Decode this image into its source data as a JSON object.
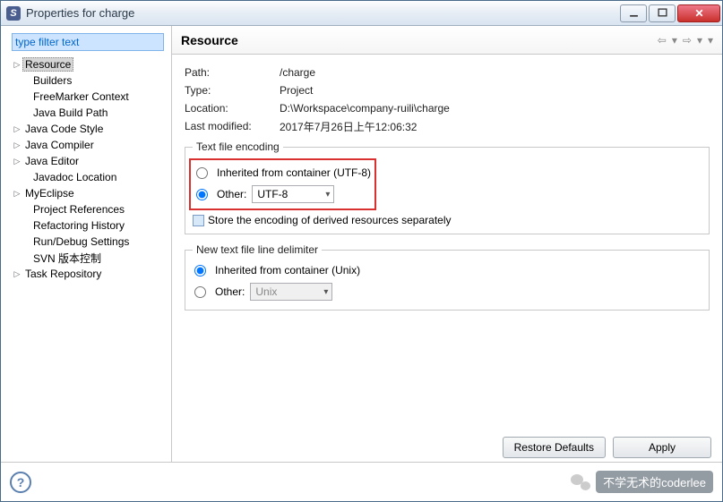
{
  "window": {
    "title": "Properties for charge"
  },
  "sidebar": {
    "filter_placeholder": "type filter text",
    "items": [
      {
        "label": "Resource",
        "expandable": true,
        "selected": true
      },
      {
        "label": "Builders",
        "child": true
      },
      {
        "label": "FreeMarker Context",
        "child": true
      },
      {
        "label": "Java Build Path",
        "child": true
      },
      {
        "label": "Java Code Style",
        "expandable": true
      },
      {
        "label": "Java Compiler",
        "expandable": true
      },
      {
        "label": "Java Editor",
        "expandable": true
      },
      {
        "label": "Javadoc Location",
        "child": true
      },
      {
        "label": "MyEclipse",
        "expandable": true
      },
      {
        "label": "Project References",
        "child": true
      },
      {
        "label": "Refactoring History",
        "child": true
      },
      {
        "label": "Run/Debug Settings",
        "child": true
      },
      {
        "label": "SVN 版本控制",
        "child": true
      },
      {
        "label": "Task Repository",
        "expandable": true
      }
    ]
  },
  "main": {
    "heading": "Resource",
    "props": {
      "path_k": "Path:",
      "path_v": "/charge",
      "type_k": "Type:",
      "type_v": "Project",
      "loc_k": "Location:",
      "loc_v": "D:\\Workspace\\company-ruili\\charge",
      "lm_k": "Last modified:",
      "lm_v": "2017年7月26日上午12:06:32"
    },
    "encoding": {
      "legend": "Text file encoding",
      "inherited_label": "Inherited from container (UTF-8)",
      "other_label": "Other:",
      "other_value": "UTF-8",
      "store_label": "Store the encoding of derived resources separately"
    },
    "delimiter": {
      "legend": "New text file line delimiter",
      "inherited_label": "Inherited from container (Unix)",
      "other_label": "Other:",
      "other_value": "Unix"
    },
    "buttons": {
      "restore": "Restore Defaults",
      "apply": "Apply"
    }
  },
  "watermark": {
    "text": "不学无术的coderlee"
  }
}
